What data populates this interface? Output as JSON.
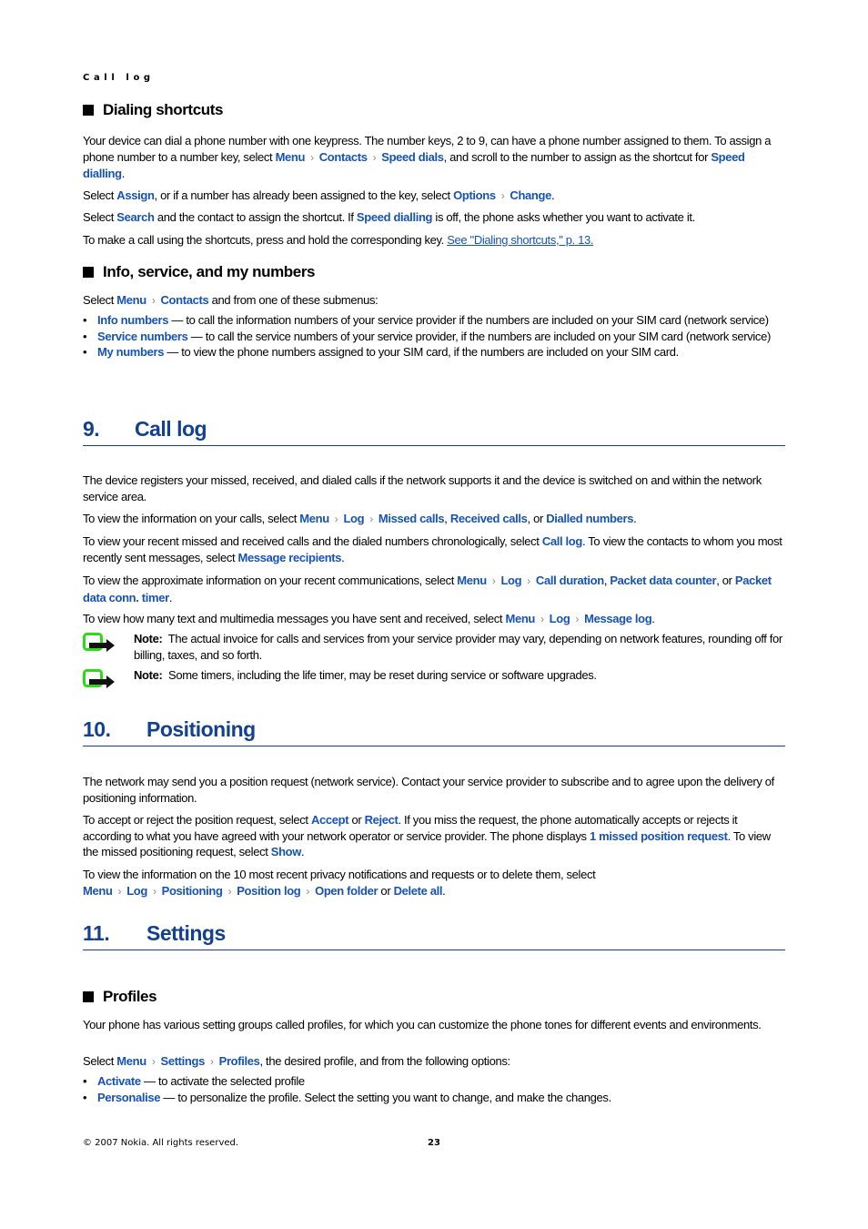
{
  "running_head": "Call log",
  "colors": {
    "accent": "#1653b5",
    "heading": "#124191",
    "note_icon_green": "#2bdc14"
  },
  "sections": {
    "dialing_shortcuts": {
      "heading": "Dialing shortcuts",
      "paras": [
        [
          {
            "t": "Your device can dial a phone number with one keypress. The number keys, 2 to 9, can have a phone number assigned to them. To assign a phone number to a number key, select "
          },
          {
            "ui": "Menu"
          },
          {
            "sep": true
          },
          {
            "ui": "Contacts"
          },
          {
            "sep": true
          },
          {
            "ui": "Speed dials"
          },
          {
            "t": ", and scroll to the number to assign as the shortcut for "
          },
          {
            "ui": "Speed dialling"
          },
          {
            "t": "."
          }
        ],
        [
          {
            "t": "Select "
          },
          {
            "ui": "Assign"
          },
          {
            "t": ", or if a number has already been assigned to the key, select "
          },
          {
            "ui": "Options"
          },
          {
            "sep": true
          },
          {
            "ui": "Change"
          },
          {
            "t": "."
          }
        ],
        [
          {
            "t": "Select "
          },
          {
            "ui": "Search"
          },
          {
            "t": " and the contact to assign the shortcut. If "
          },
          {
            "ui": "Speed dialling"
          },
          {
            "t": " is off, the phone asks whether you want to activate it."
          }
        ],
        [
          {
            "t": "To make a call using the shortcuts, press and hold the corresponding key. "
          },
          {
            "link": "See \"Dialing shortcuts,\" p. 13."
          }
        ]
      ]
    },
    "info_numbers": {
      "heading": "Info, service, and my numbers",
      "intro": [
        {
          "t": "Select "
        },
        {
          "ui": "Menu"
        },
        {
          "sep": true
        },
        {
          "ui": "Contacts"
        },
        {
          "t": " and from one of these submenus:"
        }
      ],
      "bullets": [
        [
          {
            "ui": "Info numbers"
          },
          {
            "t": " —  to call the information numbers of your service provider if the numbers are included on your SIM card (network service)"
          }
        ],
        [
          {
            "ui": "Service numbers"
          },
          {
            "t": "  — to call the service numbers of your service provider, if the numbers are included on your SIM card (network service)"
          }
        ],
        [
          {
            "ui": "My numbers"
          },
          {
            "t": " —  to view the phone numbers assigned to your SIM card, if the numbers are included on your SIM card."
          }
        ]
      ]
    },
    "call_log": {
      "number": "9.",
      "title": "Call log",
      "paras": [
        [
          {
            "t": "The device registers your missed, received, and dialed calls if the network supports it and the device is switched on and within the network service area."
          }
        ],
        [
          {
            "t": "To view the information on your calls, select "
          },
          {
            "ui": "Menu"
          },
          {
            "sep": true
          },
          {
            "ui": "Log"
          },
          {
            "sep": true
          },
          {
            "ui": "Missed calls"
          },
          {
            "t": ", "
          },
          {
            "ui": "Received calls"
          },
          {
            "t": ", or "
          },
          {
            "ui": "Dialled numbers"
          },
          {
            "t": "."
          }
        ],
        [
          {
            "t": "To view your recent missed and received calls and the dialed numbers chronologically, select "
          },
          {
            "ui": "Call log"
          },
          {
            "t": ". To view the contacts to whom you most recently sent messages, select "
          },
          {
            "ui": "Message recipients"
          },
          {
            "t": "."
          }
        ],
        [
          {
            "t": "To view the approximate information on your recent communications, select "
          },
          {
            "ui": "Menu"
          },
          {
            "sep": true
          },
          {
            "ui": "Log"
          },
          {
            "sep": true
          },
          {
            "ui": "Call duration"
          },
          {
            "t": ", "
          },
          {
            "ui": "Packet data counter"
          },
          {
            "t": ", or "
          },
          {
            "ui": "Packet data conn. timer"
          },
          {
            "t": "."
          }
        ],
        [
          {
            "t": "To view how many text and multimedia messages you have sent and received, select "
          },
          {
            "ui": "Menu"
          },
          {
            "sep": true
          },
          {
            "ui": "Log"
          },
          {
            "sep": true
          },
          {
            "ui": "Message log"
          },
          {
            "t": "."
          }
        ]
      ],
      "notes": [
        {
          "label": "Note:",
          "text": "The actual invoice for calls and services from your service provider may vary, depending on network features, rounding off for billing, taxes, and so forth."
        },
        {
          "label": "Note:",
          "text": "Some timers, including the life timer, may be reset during service or software upgrades."
        }
      ]
    },
    "positioning": {
      "number": "10.",
      "title": "Positioning",
      "paras": [
        [
          {
            "t": "The network may send you a position request (network service). Contact your service provider to subscribe and to agree upon the delivery of positioning information."
          }
        ],
        [
          {
            "t": "To accept or reject the position request, select "
          },
          {
            "ui": "Accept"
          },
          {
            "t": " or "
          },
          {
            "ui": "Reject"
          },
          {
            "t": ". If you miss the request, the phone automatically accepts or rejects it according to what you have agreed with your network operator or service provider. The phone displays "
          },
          {
            "ui": "1 missed position request"
          },
          {
            "t": ". To view the missed positioning request, select "
          },
          {
            "ui": "Show"
          },
          {
            "t": "."
          }
        ],
        [
          {
            "t": "To view the information on the 10 most recent privacy notifications and requests or to delete them, select "
          },
          {
            "ui": "Menu"
          },
          {
            "sep": true
          },
          {
            "ui": "Log"
          },
          {
            "sep": true
          },
          {
            "ui": "Positioning"
          },
          {
            "sep": true
          },
          {
            "ui": "Position log"
          },
          {
            "sep": true
          },
          {
            "ui": "Open folder"
          },
          {
            "t": " or "
          },
          {
            "ui": "Delete all"
          },
          {
            "t": "."
          }
        ]
      ]
    },
    "settings": {
      "number": "11.",
      "title": "Settings",
      "profiles": {
        "heading": "Profiles",
        "paras": [
          [
            {
              "t": "Your phone has various setting groups called profiles, for which you can customize the phone tones for different events and environments."
            }
          ],
          [
            {
              "t": "Select "
            },
            {
              "ui": "Menu"
            },
            {
              "sep": true
            },
            {
              "ui": "Settings"
            },
            {
              "sep": true
            },
            {
              "ui": "Profiles"
            },
            {
              "t": ", the desired profile, and from the following options:"
            }
          ]
        ],
        "bullets": [
          [
            {
              "ui": "Activate"
            },
            {
              "t": " — to activate the selected profile"
            }
          ],
          [
            {
              "ui": "Personalise"
            },
            {
              "t": " — to personalize the profile. Select the setting you want to change, and make the changes."
            }
          ]
        ]
      }
    }
  },
  "footer": {
    "copyright": "© 2007 Nokia. All rights reserved.",
    "page_number": "23"
  }
}
